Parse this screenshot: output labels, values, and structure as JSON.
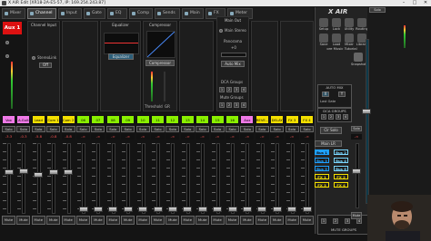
{
  "window": {
    "title": "X AIR Edit [XR18-2A-E5-57, IP: 169.254.243.87]",
    "minimize_glyph": "–",
    "maximize_glyph": "□",
    "close_glyph": "✕"
  },
  "tabs": [
    {
      "label": "Mixer",
      "active": false
    },
    {
      "label": "Channel",
      "active": true
    },
    {
      "label": "Input",
      "active": false
    },
    {
      "label": "Gate",
      "active": false
    },
    {
      "label": "EQ",
      "active": false
    },
    {
      "label": "Comp",
      "active": false
    },
    {
      "label": "Sends",
      "active": false
    },
    {
      "label": "Main",
      "active": false
    },
    {
      "label": "FX",
      "active": false
    },
    {
      "label": "Meter",
      "active": false
    }
  ],
  "selected_channel": {
    "label": "Aux 1",
    "color": "#dd1111"
  },
  "channel_input": {
    "title": "Channel Input",
    "stereo_link": "StereoLink",
    "delay_value": "Off"
  },
  "equalizer": {
    "title": "Equalizer",
    "button_label": "Equalizer"
  },
  "compressor": {
    "title": "Compressor",
    "button_label": "Compressor",
    "threshold_label": "Threshold",
    "gr_label": "GR"
  },
  "main_out": {
    "title": "Main Out",
    "main_stereo": "Main Stereo",
    "panorama_label": "Panorama",
    "panorama_value": "+0",
    "auto_mix": "Auto Mix",
    "dca_groups_title": "DCA Groups",
    "dca": [
      "1",
      "2",
      "3",
      "4"
    ],
    "mute_groups_title": "Mute Groups",
    "mute_groups": [
      "1",
      "2",
      "3",
      "4"
    ]
  },
  "strips": [
    {
      "name": "Vox",
      "color": "#f07ae8",
      "level": "-3.3",
      "fader": 0.42
    },
    {
      "name": "A.Guit",
      "color": "#f07ae8",
      "level": "-0.3",
      "fader": 0.4
    },
    {
      "name": "Lead Guitar",
      "color": "#f4e000",
      "level": "-5.8",
      "fader": 0.45
    },
    {
      "name": "Com 1",
      "color": "#f4e000",
      "level": "-0.8",
      "fader": 0.41
    },
    {
      "name": "Com 2",
      "color": "#f4e000",
      "level": "-0.8",
      "fader": 0.41
    },
    {
      "name": "06",
      "color": "#8af000",
      "level": "-∞",
      "fader": 1.0
    },
    {
      "name": "07",
      "color": "#8af000",
      "level": "-∞",
      "fader": 1.0
    },
    {
      "name": "08",
      "color": "#8af000",
      "level": "-∞",
      "fader": 1.0
    },
    {
      "name": "09",
      "color": "#8af000",
      "level": "-∞",
      "fader": 1.0
    },
    {
      "name": "10",
      "color": "#8af000",
      "level": "-∞",
      "fader": 1.0
    },
    {
      "name": "11",
      "color": "#8af000",
      "level": "-∞",
      "fader": 1.0
    },
    {
      "name": "12",
      "color": "#8af000",
      "level": "-∞",
      "fader": 1.0
    },
    {
      "name": "13",
      "color": "#8af000",
      "level": "-∞",
      "fader": 1.0
    },
    {
      "name": "14",
      "color": "#8af000",
      "level": "-∞",
      "fader": 1.0
    },
    {
      "name": "15",
      "color": "#8af000",
      "level": "-∞",
      "fader": 1.0
    },
    {
      "name": "16",
      "color": "#8af000",
      "level": "-∞",
      "fader": 1.0
    },
    {
      "name": "Aux 1/2",
      "color": "#f07ae8",
      "level": "-∞",
      "fader": 1.0
    },
    {
      "name": "REVE...",
      "color": "#f4e000",
      "level": "-∞",
      "fader": 1.0
    },
    {
      "name": "DELAY",
      "color": "#f4e000",
      "level": "-∞",
      "fader": 1.0
    },
    {
      "name": "FX 3",
      "color": "#f4e000",
      "level": "-∞",
      "fader": 1.0
    },
    {
      "name": "FX 4",
      "color": "#f4e000",
      "level": "-∞",
      "fader": 1.0
    }
  ],
  "strip_solo_label": "Solo",
  "strip_mute_label": "Mute",
  "sidebar": {
    "brand": "X AIR",
    "icons": [
      {
        "label": "Setup"
      },
      {
        "label": "Lock"
      },
      {
        "label": "Utility"
      },
      {
        "label": "Routing"
      },
      {
        "label": "Save"
      },
      {
        "label": "Load"
      },
      {
        "label": "Mixer"
      },
      {
        "label": "Library"
      }
    ],
    "scene_label": "ore Music Tutorial",
    "snapshot_label": "Snapshot",
    "auto_mix": {
      "title": "AUTO MIX",
      "x": "X",
      "y": "Y",
      "last_gate": "Last Gate"
    },
    "dca_groups": {
      "title": "DCA GROUPS",
      "items": [
        "1",
        "2",
        "3",
        "4"
      ]
    },
    "clr_solo": "Clr Solo",
    "mute_groups": {
      "title": "MUTE GROUPS",
      "items": [
        "1",
        "2",
        "3",
        "4"
      ]
    }
  },
  "main_strip": {
    "main_lr": "Main LR",
    "buses": [
      {
        "label": "Bus 1",
        "color": "#1ea0ff",
        "active": true
      },
      {
        "label": "Bus 2",
        "color": "#7ad7ff",
        "active": false
      },
      {
        "label": "Bus 3",
        "color": "#1ea0ff",
        "active": false
      },
      {
        "label": "Bus 4",
        "color": "#7ad7ff",
        "active": false
      },
      {
        "label": "Bus 5",
        "color": "#1ea0ff",
        "active": false
      },
      {
        "label": "Bus 6",
        "color": "#7ad7ff",
        "active": false
      },
      {
        "label": "FX 1",
        "color": "#f4e000",
        "active": false
      },
      {
        "label": "FX 2",
        "color": "#f4e000",
        "active": false
      },
      {
        "label": "FX 3",
        "color": "#f4e000",
        "active": false
      },
      {
        "label": "FX 4",
        "color": "#f4e000",
        "active": false
      }
    ],
    "solo_label": "Solo",
    "solo_label_2": "Solo",
    "mute_label": "Mute",
    "level_value": "-∞",
    "bus_fader": 0.43,
    "main_fader": 0.45
  }
}
